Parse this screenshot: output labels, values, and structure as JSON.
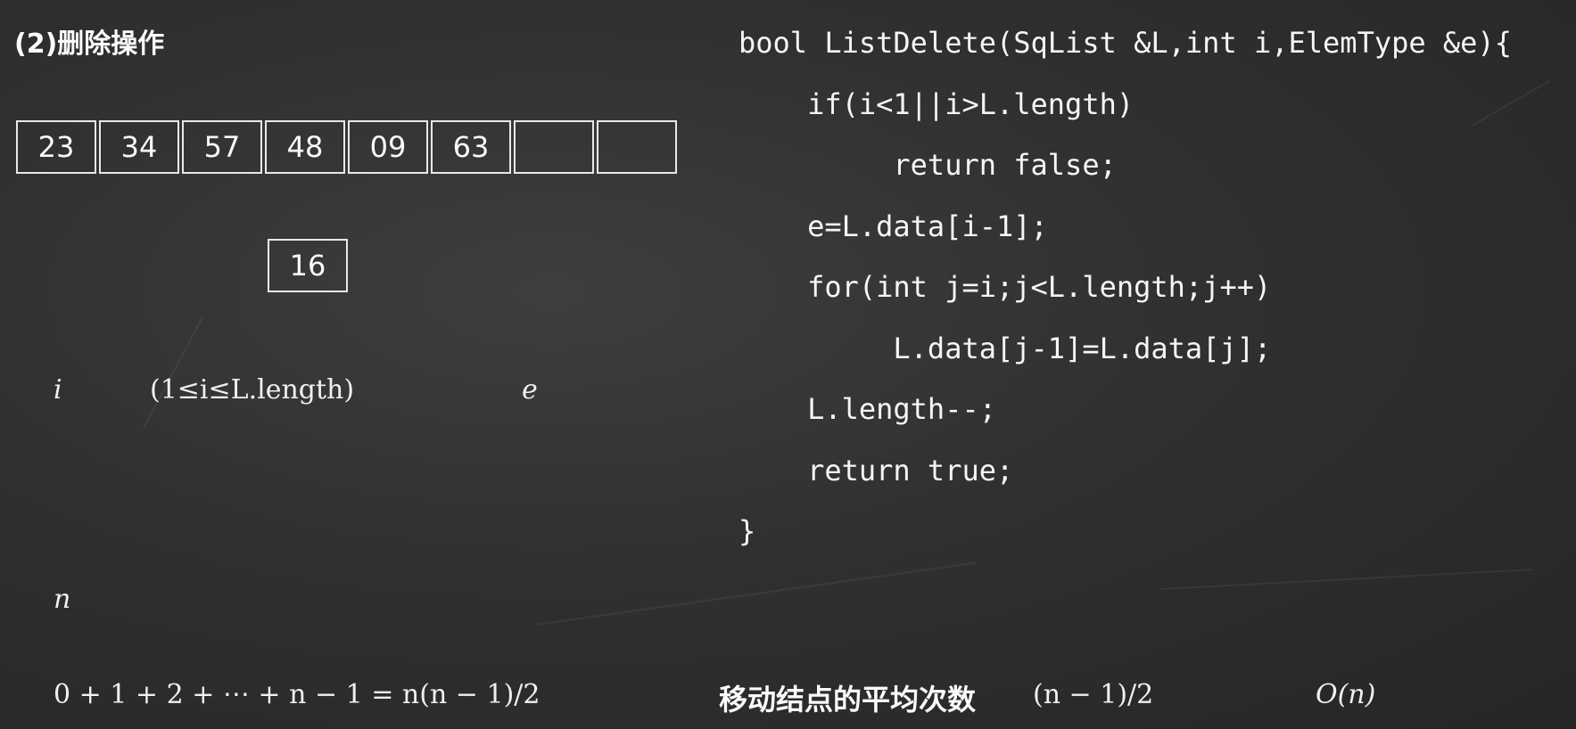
{
  "title": "(2)删除操作",
  "array": {
    "cells": [
      "23",
      "34",
      "57",
      "48",
      "09",
      "63",
      "",
      ""
    ]
  },
  "deleted_value": "16",
  "math": {
    "i_label": "i",
    "range": "(1≤i≤L.length)",
    "e_label": "e",
    "n_label": "n",
    "sum_formula": "0 + 1 + 2 + ⋯ + n − 1 = n(n − 1)/2",
    "avg_value": "(n − 1)/2",
    "complexity": "O(n)"
  },
  "code": {
    "lines": [
      "bool ListDelete(SqList &L,int i,ElemType &e){",
      "    if(i<1||i>L.length)",
      "         return false;",
      "    e=L.data[i-1];",
      "    for(int j=i;j<L.length;j++)",
      "         L.data[j-1]=L.data[j];",
      "    L.length--;",
      "    return true;",
      "}"
    ]
  },
  "bottom": {
    "avg_label": "移动结点的平均次数"
  }
}
